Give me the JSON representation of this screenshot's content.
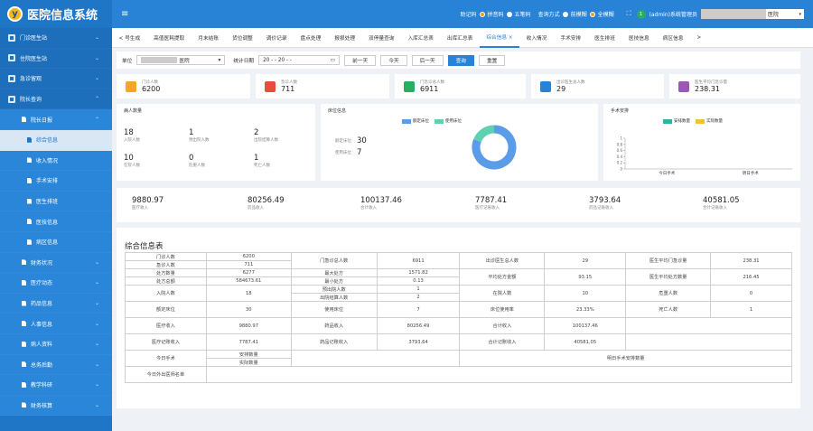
{
  "app_title": "医院信息系统",
  "logo_letter": "y",
  "sidebar": {
    "items": [
      {
        "label": "门诊医生站",
        "type": "top"
      },
      {
        "label": "住院医生站",
        "type": "top"
      },
      {
        "label": "急诊留观",
        "type": "top"
      },
      {
        "label": "院长查询",
        "type": "top",
        "arrow": "^"
      },
      {
        "label": "院长日报",
        "type": "sub2",
        "arrow": "^"
      },
      {
        "label": "综合信息",
        "type": "sub",
        "active": true
      },
      {
        "label": "收入情况",
        "type": "sub"
      },
      {
        "label": "手术安排",
        "type": "sub"
      },
      {
        "label": "医生排班",
        "type": "sub"
      },
      {
        "label": "医技信息",
        "type": "sub"
      },
      {
        "label": "病区信息",
        "type": "sub"
      },
      {
        "label": "财务状况",
        "type": "sub2"
      },
      {
        "label": "医疗动态",
        "type": "sub2"
      },
      {
        "label": "药品信息",
        "type": "sub2"
      },
      {
        "label": "人事信息",
        "type": "sub2"
      },
      {
        "label": "病人资料",
        "type": "sub2"
      },
      {
        "label": "总务后勤",
        "type": "sub2"
      },
      {
        "label": "教学科研",
        "type": "sub2"
      },
      {
        "label": "财务核算",
        "type": "sub2"
      }
    ]
  },
  "topbar": {
    "mnemonic_label": "助记码",
    "pinyin": "拼音码",
    "wubi": "五笔码",
    "query_label": "查询方式",
    "fuzzy": "前模糊",
    "full_fuzzy": "全模糊",
    "user_badge": "1",
    "user": "(admin)系统管理员",
    "dept_value": "医院",
    "colors": {
      "orange": "#f39c12",
      "white": "#ffffff",
      "green": "#27ae60"
    }
  },
  "tabs": [
    "< 号生成",
    "高值医耗提取",
    "月末结账",
    "货位调整",
    "调价记录",
    "盘点处理",
    "报损处理",
    "双停量查询",
    "入库汇总表",
    "出库汇总表",
    "综合信息 ×",
    "收入情况",
    "手术安排",
    "医生排班",
    "医技信息",
    "病区信息",
    ">"
  ],
  "active_tab": 10,
  "filter": {
    "unit_label": "单位",
    "unit_value": "医院",
    "date_label": "统计日期",
    "date_value": "20   -   -  20   -  -",
    "prev": "前一天",
    "today": "今天",
    "next": "后一天",
    "query": "查询",
    "reset": "重置"
  },
  "stats": [
    {
      "label": "门诊人数",
      "value": "6200",
      "color": "#f5a623"
    },
    {
      "label": "急诊人数",
      "value": "711",
      "color": "#e74c3c"
    },
    {
      "label": "门急诊总人数",
      "value": "6911",
      "color": "#27ae60"
    },
    {
      "label": "出诊医生总人数",
      "value": "29",
      "color": "#2883d6"
    },
    {
      "label": "医生平均门急诊量",
      "value": "238.31",
      "color": "#9b59b6"
    }
  ],
  "patients": {
    "title": "病人数量",
    "cells": [
      {
        "value": "18",
        "label": "入院人数"
      },
      {
        "value": "1",
        "label": "预出院人数"
      },
      {
        "value": "2",
        "label": "出院结算人数"
      },
      {
        "value": "10",
        "label": "在院人数"
      },
      {
        "value": "0",
        "label": "危重人数"
      },
      {
        "value": "1",
        "label": "死亡人数"
      }
    ]
  },
  "beds": {
    "title": "床位信息",
    "legend": [
      "额定床位",
      "使用床位"
    ],
    "rated_label": "额定床位",
    "rated": "30",
    "used_label": "使用床位",
    "used": "7",
    "colors": [
      "#5b9ce8",
      "#5ed1b1"
    ],
    "chart_data": {
      "type": "pie",
      "labels": [
        "额定床位",
        "使用床位"
      ],
      "values": [
        30,
        7
      ]
    }
  },
  "surgery": {
    "title": "手术安排",
    "legend": [
      "安排数量",
      "实际数量"
    ],
    "colors": [
      "#2bb5a3",
      "#f5c12e"
    ],
    "chart_data": {
      "type": "bar",
      "categories": [
        "今日手术",
        "明日手术"
      ],
      "series": [
        {
          "name": "安排数量",
          "values": [
            0,
            0
          ]
        },
        {
          "name": "实际数量",
          "values": [
            0,
            0
          ]
        }
      ],
      "ylim": [
        0,
        1
      ],
      "yticks": [
        "1",
        "0.8",
        "0.6",
        "0.4",
        "0.2",
        "0"
      ]
    }
  },
  "money": [
    {
      "value": "9880.97",
      "label": "医疗收入"
    },
    {
      "value": "80256.49",
      "label": "药品收入"
    },
    {
      "value": "100137.46",
      "label": "合计收入"
    },
    {
      "value": "7787.41",
      "label": "医疗记账收入"
    },
    {
      "value": "3793.64",
      "label": "药品记账收入"
    },
    {
      "value": "40581.05",
      "label": "合计记账收入"
    }
  ],
  "summary": {
    "title": "综合信息表",
    "r1": {
      "a": "门诊人数",
      "av": "6200",
      "b": "急诊人数",
      "bv": "711",
      "c": "门急诊总人数",
      "cv": "6911",
      "d": "出诊医生总人数",
      "dv": "29",
      "e": "医生平均门急诊量",
      "ev": "238.31"
    },
    "r2": {
      "a": "处方数量",
      "av": "6277",
      "b": "处方总额",
      "bv": "584673.61",
      "c": "最大处方",
      "cv": "1571.82",
      "c2": "最小处方",
      "c2v": "0.13",
      "d": "平均处方金额",
      "dv": "93.15",
      "e": "医生平均处方数量",
      "ev": "216.45"
    },
    "r3": {
      "a": "入院人数",
      "av": "18",
      "b": "预出院人数",
      "bv": "1",
      "b2": "出院结算人数",
      "b2v": "2",
      "c": "在院人数",
      "cv": "10",
      "d": "危重人数",
      "dv": "0"
    },
    "r4": {
      "a": "额定床位",
      "av": "30",
      "b": "使用床位",
      "bv": "7",
      "c": "床位使用率",
      "cv": "23.33%",
      "d": "死亡人数",
      "dv": "1"
    },
    "r5": {
      "a": "医疗收入",
      "av": "9880.97",
      "b": "药品收入",
      "bv": "80256.49",
      "c": "合计收入",
      "cv": "100137.46"
    },
    "r6": {
      "a": "医疗记账收入",
      "av": "7787.41",
      "b": "药品记账收入",
      "bv": "3793.64",
      "c": "合计记账收入",
      "cv": "40581.05"
    },
    "r7": {
      "a": "今日手术",
      "b": "安排数量",
      "b2": "实际数量",
      "c": "明日手术安排数量"
    },
    "r8": {
      "a": "今日外出医师名单"
    }
  }
}
